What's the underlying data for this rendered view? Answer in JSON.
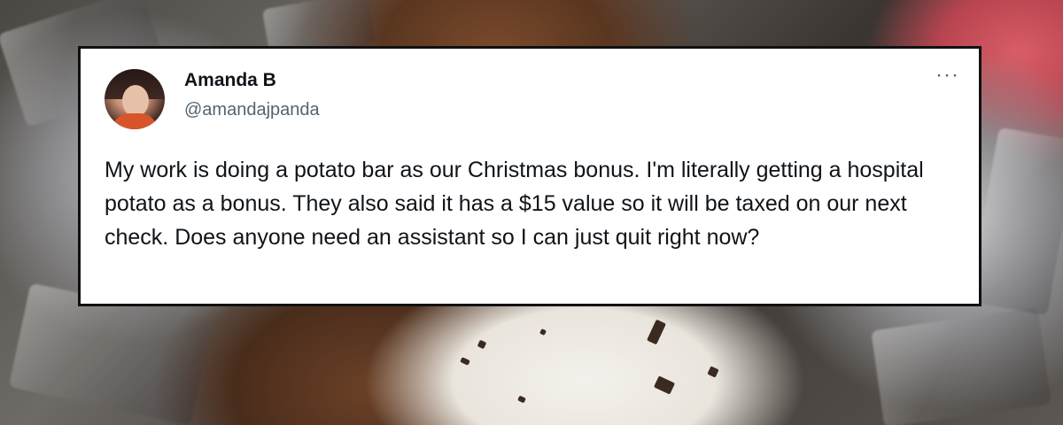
{
  "tweet": {
    "author_name": "Amanda B",
    "author_handle": "@amandajpanda",
    "more_label": "···",
    "text": "My work is doing a potato bar as our Christmas bonus. I'm literally getting a hospital potato as a bonus. They also said it has a $15 value so it will be taxed on our next check. Does anyone need an assistant so I can just quit right now?"
  },
  "icons": {
    "avatar": "avatar",
    "more": "more-options-icon"
  }
}
